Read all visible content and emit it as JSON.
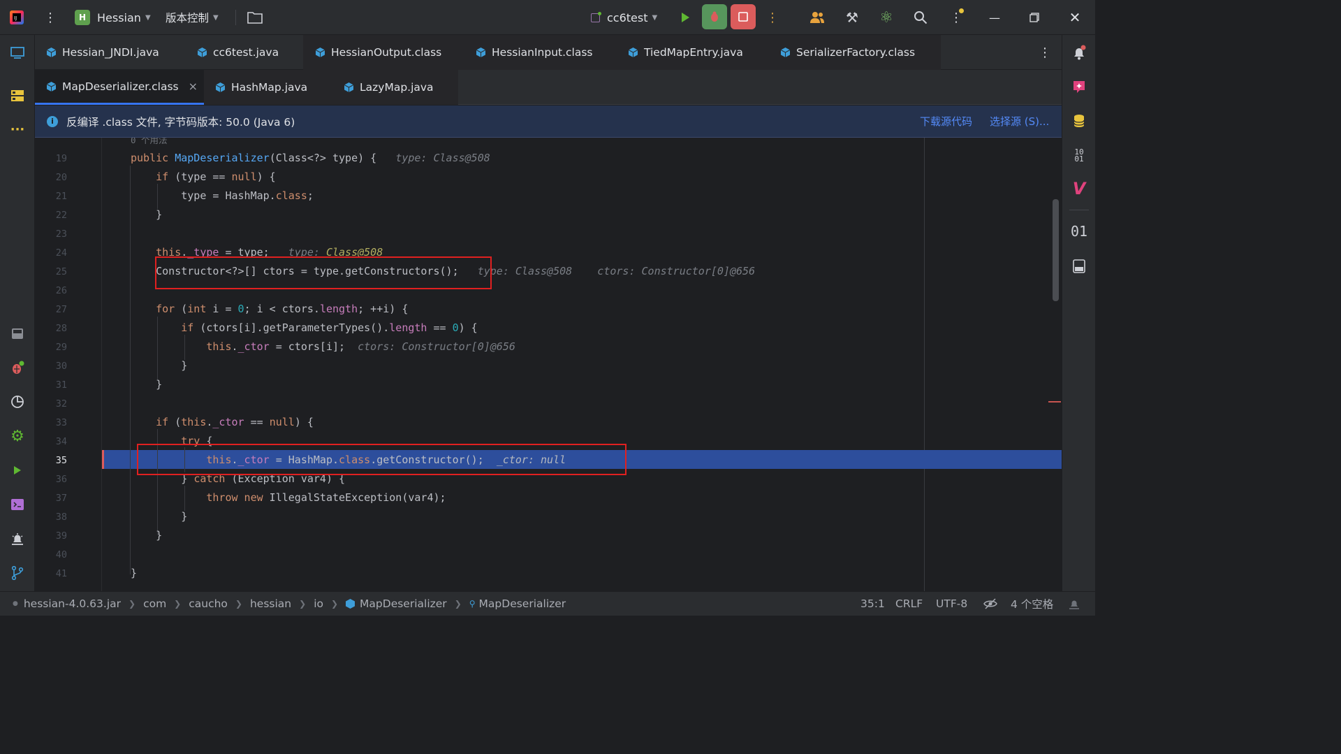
{
  "titlebar": {
    "project_initial": "H",
    "project_name": "Hessian",
    "vcs_label": "版本控制",
    "run_config": "cc6test"
  },
  "tabs_row1": [
    {
      "label": "Hessian_JNDI.java"
    },
    {
      "label": "cc6test.java"
    },
    {
      "label": "HessianOutput.class"
    },
    {
      "label": "HessianInput.class"
    },
    {
      "label": "TiedMapEntry.java"
    },
    {
      "label": "SerializerFactory.class"
    }
  ],
  "tabs_row2": [
    {
      "label": "MapDeserializer.class",
      "close": "×"
    },
    {
      "label": "HashMap.java"
    },
    {
      "label": "LazyMap.java"
    }
  ],
  "infobar": {
    "message": "反编译 .class 文件, 字节码版本: 50.0 (Java 6)",
    "download_link": "下载源代码",
    "choose_link": "选择源 (S)..."
  },
  "editor": {
    "usage_hint": "0 个用法",
    "line_numbers": [
      "19",
      "20",
      "21",
      "22",
      "23",
      "24",
      "25",
      "26",
      "27",
      "28",
      "29",
      "30",
      "31",
      "32",
      "33",
      "34",
      "35",
      "36",
      "37",
      "38",
      "39",
      "40",
      "41"
    ],
    "current_line": "35",
    "hints": {
      "l19": "type: Class@508",
      "l24": "type: Class@508",
      "l25a": "type: Class@508",
      "l25b": "ctors: Constructor[0]@656",
      "l29": "ctors: Constructor[0]@656",
      "l35": "_ctor: null"
    }
  },
  "rightbar": {
    "bytecode_label": "10 01",
    "binary_label": "01"
  },
  "statusbar": {
    "breadcrumbs": [
      "hessian-4.0.63.jar",
      "com",
      "caucho",
      "hessian",
      "io",
      "MapDeserializer",
      "MapDeserializer"
    ],
    "position": "35:1",
    "line_sep": "CRLF",
    "encoding": "UTF-8",
    "indent": "4 个空格"
  },
  "colors": {
    "accent": "#3574f0",
    "highlight_line": "#2d4e9c",
    "breakpoint": "#db5c5c",
    "debug_green": "#57965c",
    "stop_red": "#db5c5c"
  }
}
